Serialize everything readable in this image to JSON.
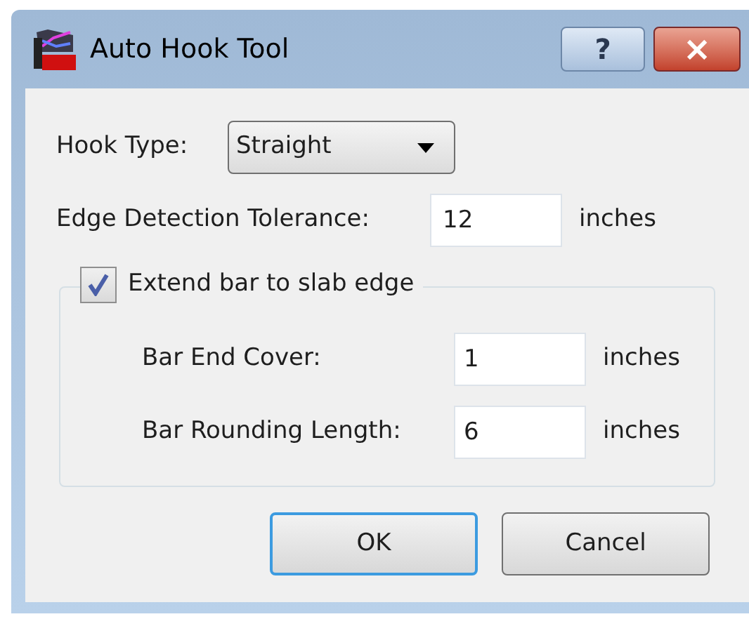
{
  "window": {
    "title": "Auto Hook Tool",
    "help_button": "?",
    "close_button": "×"
  },
  "hook_type": {
    "label": "Hook Type:",
    "value": "Straight"
  },
  "edge_tolerance": {
    "label": "Edge Detection Tolerance:",
    "value": "12",
    "unit": "inches"
  },
  "extend_group": {
    "label": "Extend bar to slab edge",
    "checked": true,
    "fields": [
      {
        "label": "Bar End Cover:",
        "value": "1",
        "unit": "inches"
      },
      {
        "label": "Bar Rounding Length:",
        "value": "6",
        "unit": "inches"
      }
    ]
  },
  "buttons": [
    {
      "label": "OK",
      "default": true
    },
    {
      "label": "Cancel",
      "default": false
    }
  ]
}
